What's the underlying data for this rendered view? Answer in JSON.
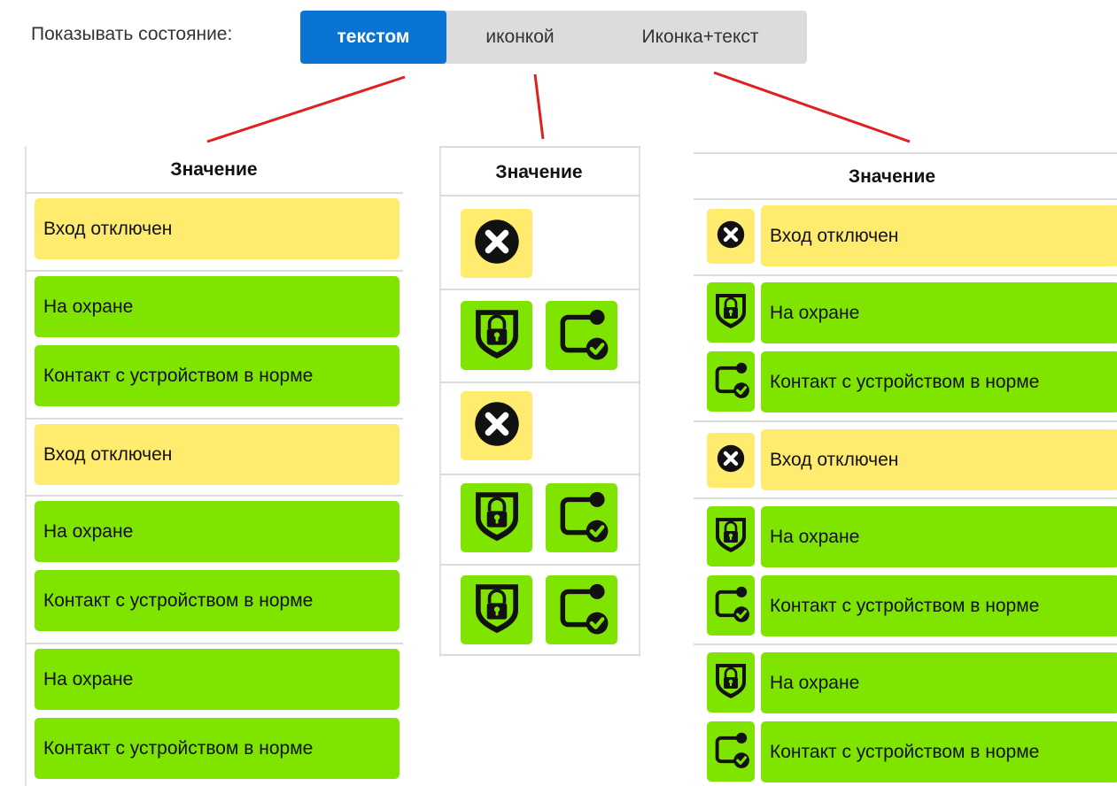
{
  "toolbar": {
    "label": "Показывать состояние:",
    "options": [
      "текстом",
      "иконкой",
      "Иконка+текст"
    ],
    "selected": "текстом"
  },
  "colors": {
    "accent": "#0a74d4",
    "warning": "#ffec6e",
    "ok": "#7ee400",
    "pointer_lines": "#e02020"
  },
  "tables": {
    "text": {
      "header": "Значение",
      "groups": [
        [
          "Вход отключен"
        ],
        [
          "На охране",
          "Контакт с устройством в норме"
        ],
        [
          "Вход отключен"
        ],
        [
          "На охране",
          "Контакт с устройством в норме"
        ],
        [
          "На охране",
          "Контакт с устройством в норме"
        ]
      ]
    },
    "icon": {
      "header": "Значение",
      "groups": [
        [
          "x-circle-icon"
        ],
        [
          "shield-lock-icon",
          "device-contact-ok-icon"
        ],
        [
          "x-circle-icon"
        ],
        [
          "shield-lock-icon",
          "device-contact-ok-icon"
        ],
        [
          "shield-lock-icon",
          "device-contact-ok-icon"
        ]
      ]
    },
    "icon_text": {
      "header": "Значение",
      "groups": [
        [
          {
            "icon": "x-circle-icon",
            "text": "Вход отключен"
          }
        ],
        [
          {
            "icon": "shield-lock-icon",
            "text": "На охране"
          },
          {
            "icon": "device-contact-ok-icon",
            "text": "Контакт с устройством в норме"
          }
        ],
        [
          {
            "icon": "x-circle-icon",
            "text": "Вход отключен"
          }
        ],
        [
          {
            "icon": "shield-lock-icon",
            "text": "На охране"
          },
          {
            "icon": "device-contact-ok-icon",
            "text": "Контакт с устройством в норме"
          }
        ],
        [
          {
            "icon": "shield-lock-icon",
            "text": "На охране"
          },
          {
            "icon": "device-contact-ok-icon",
            "text": "Контакт с устройством в норме"
          }
        ]
      ]
    }
  }
}
